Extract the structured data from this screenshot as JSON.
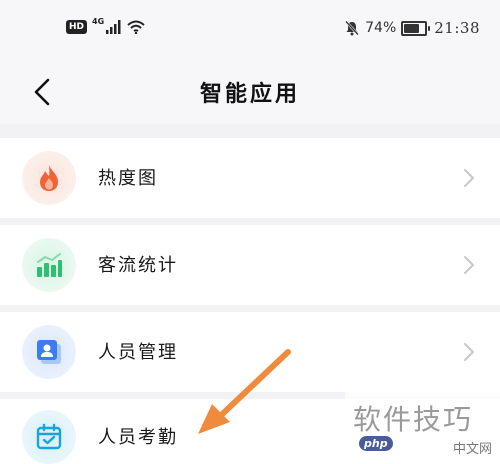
{
  "status_bar": {
    "hd_badge": "HD",
    "network": "4G",
    "battery_text": "74%",
    "battery_level": 0.74,
    "time": "21:38"
  },
  "header": {
    "title": "智能应用"
  },
  "menu": {
    "items": [
      {
        "label": "热度图",
        "icon": "flame-icon",
        "accent": "#f0623a"
      },
      {
        "label": "客流统计",
        "icon": "bar-chart-icon",
        "accent": "#2fbf71"
      },
      {
        "label": "人员管理",
        "icon": "person-card-icon",
        "accent": "#3d7cf0"
      },
      {
        "label": "人员考勤",
        "icon": "calendar-check-icon",
        "accent": "#1aa3d9"
      }
    ]
  },
  "annotation": {
    "arrow_color": "#f08a3c"
  },
  "watermark": {
    "text": "软件技巧",
    "badge": "php",
    "sub": "中文网"
  }
}
